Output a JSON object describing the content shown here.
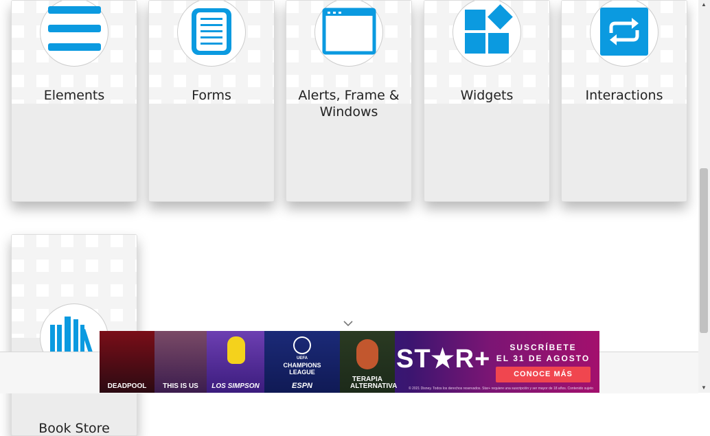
{
  "cards": [
    {
      "title": "Elements",
      "icon": "hamburger-list-icon"
    },
    {
      "title": "Forms",
      "icon": "form-document-icon"
    },
    {
      "title": "Alerts, Frame & Windows",
      "icon": "browser-window-icon"
    },
    {
      "title": "Widgets",
      "icon": "widgets-blocks-icon"
    },
    {
      "title": "Interactions",
      "icon": "repeat-arrows-icon"
    },
    {
      "title": "Book Store Application",
      "icon": "books-icon"
    }
  ],
  "colors": {
    "accent": "#0b9ae0",
    "card_bg": "#ececec",
    "ad_cta": "#f0464f"
  },
  "ad": {
    "panels": [
      "DEADPOOL",
      "THIS IS US",
      "LOS SIMPSON",
      "CHAMPIONS LEAGUE",
      "ESPN",
      "TERAPIA ALTERNATIVA"
    ],
    "uefa": "UEFA",
    "brand": "ST★R+",
    "line1": "SUSCRÍBETE",
    "line2": "EL 31 DE AGOSTO",
    "cta": "CONOCE MÁS",
    "fineprint": "© 2021 Disney. Todos los derechos reservados. Star+ requiere una suscripción y ser mayor de 18 años. Contenido sujeto a disponibilidad."
  }
}
